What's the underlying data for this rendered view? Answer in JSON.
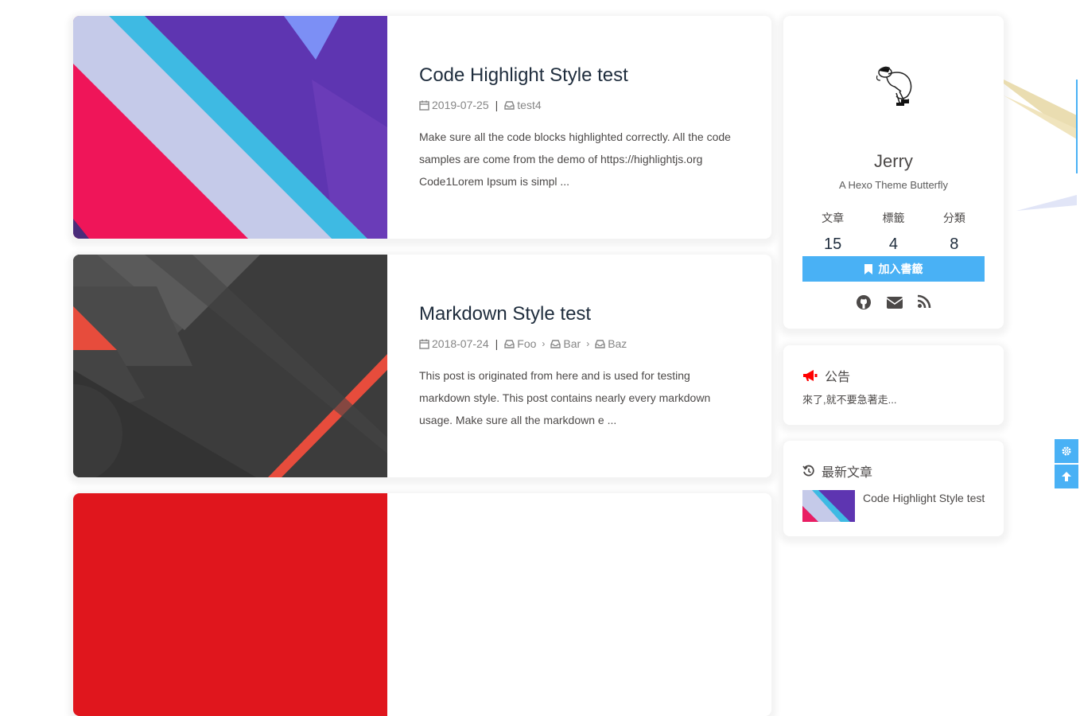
{
  "posts": [
    {
      "title": "Code Highlight Style test",
      "date": "2019-07-25",
      "categories": [
        "test4"
      ],
      "excerpt": "Make sure all the code blocks highlighted correctly. All the code samples are come from the demo of https://highlightjs.org Code1Lorem Ipsum is simpl ..."
    },
    {
      "title": "Markdown Style test",
      "date": "2018-07-24",
      "categories": [
        "Foo",
        "Bar",
        "Baz"
      ],
      "excerpt": "This post is originated from here and is used for testing markdown style. This post contains nearly every markdown usage. Make sure all the markdown e ..."
    }
  ],
  "author": {
    "name": "Jerry",
    "description": "A Hexo Theme Butterfly",
    "stats": [
      {
        "label": "文章",
        "value": "15"
      },
      {
        "label": "標籤",
        "value": "4"
      },
      {
        "label": "分類",
        "value": "8"
      }
    ],
    "bookmark_label": "加入書籤",
    "socials": [
      "github-icon",
      "envelope-icon",
      "rss-icon"
    ]
  },
  "announcement": {
    "title": "公告",
    "text": "來了,就不要急著走..."
  },
  "recent": {
    "title": "最新文章",
    "items": [
      {
        "title": "Code Highlight Style test"
      }
    ]
  },
  "colors": {
    "accent": "#49b1f5",
    "announcement_icon": "#ff0000"
  }
}
